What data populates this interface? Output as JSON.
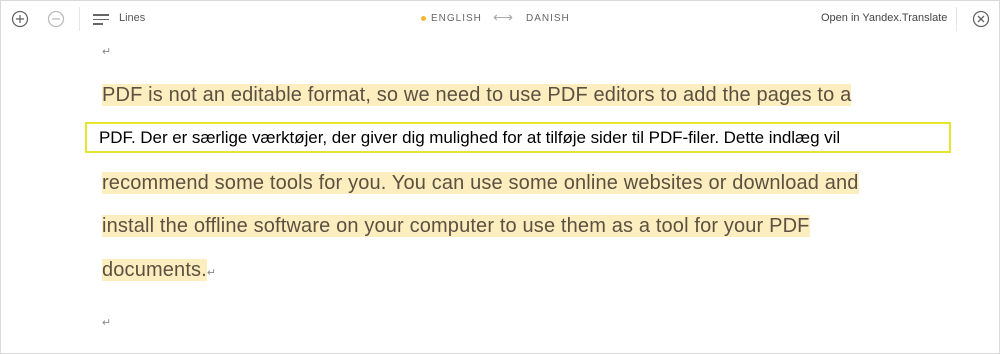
{
  "toolbar": {
    "lines_label": "Lines",
    "source_language": "ENGLISH",
    "target_language": "DANISH",
    "swap_icon": "left-right-arrow-icon",
    "open_link": "Open in Yandex.Translate",
    "accent_color": "#f5b533"
  },
  "content": {
    "return_symbol": "↵",
    "lines": [
      "PDF is not an editable format, so we need to use PDF editors to add the pages to a",
      "recommend some tools for you. You can use some online websites or download and",
      "install the offline software on your computer to use them as a tool for your PDF",
      "documents."
    ],
    "translation": "PDF. Der er særlige værktøjer, der giver dig mulighed for at tilføje sider til PDF-filer. Dette indlæg vil",
    "highlight_color": "#fdeec0",
    "selection_border_color": "#e6e62e"
  }
}
